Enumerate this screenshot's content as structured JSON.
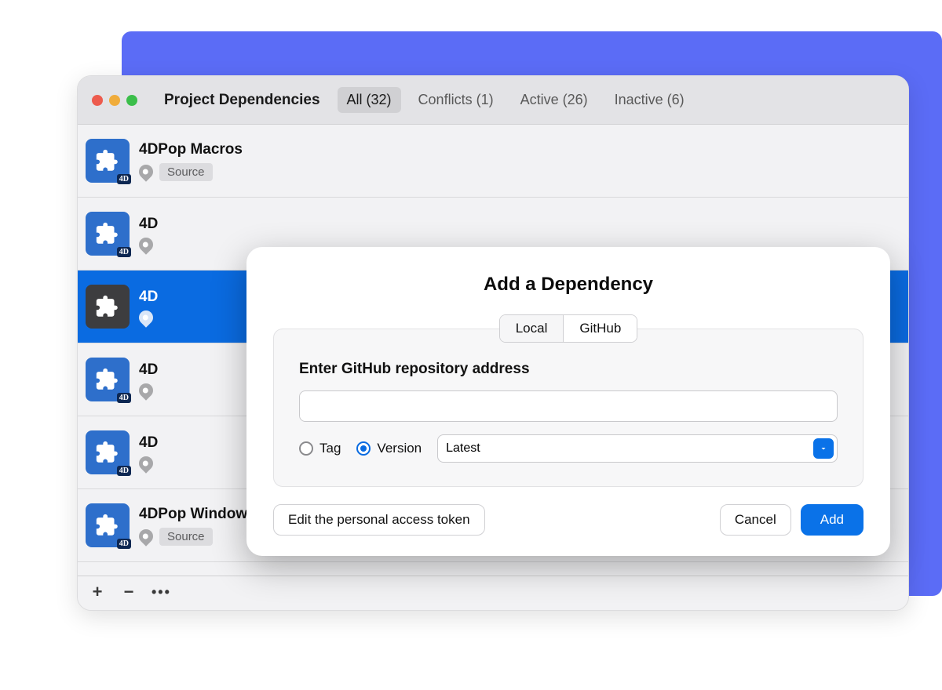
{
  "window": {
    "title": "Project Dependencies",
    "filters": [
      {
        "label": "All (32)",
        "active": true
      },
      {
        "label": "Conflicts (1)",
        "active": false
      },
      {
        "label": "Active (26)",
        "active": false
      },
      {
        "label": "Inactive (6)",
        "active": false
      }
    ]
  },
  "list": [
    {
      "name": "4DPop Macros",
      "source": "Source",
      "badge": "4D",
      "selected": false
    },
    {
      "name": "4D",
      "source": "",
      "badge": "4D",
      "selected": false
    },
    {
      "name": "4D",
      "source": "",
      "badge": "",
      "selected": true
    },
    {
      "name": "4D",
      "source": "",
      "badge": "4D",
      "selected": false
    },
    {
      "name": "4D",
      "source": "",
      "badge": "4D",
      "selected": false
    },
    {
      "name": "4DPop Window",
      "source": "Source",
      "badge": "4D",
      "selected": false
    }
  ],
  "footer": {
    "add": "+",
    "remove": "−",
    "more": "•••"
  },
  "modal": {
    "title": "Add a Dependency",
    "tabs": {
      "local": "Local",
      "github": "GitHub",
      "active": "github"
    },
    "prompt": "Enter GitHub repository address",
    "address_value": "",
    "options": {
      "tag": {
        "label": "Tag",
        "selected": false
      },
      "version": {
        "label": "Version",
        "selected": true
      }
    },
    "version_select": "Latest",
    "buttons": {
      "edit_token": "Edit the personal access token",
      "cancel": "Cancel",
      "add": "Add"
    }
  },
  "colors": {
    "accent": "#0a72e8",
    "selection": "#0a6be1",
    "backdrop": "#5b6cf6"
  }
}
